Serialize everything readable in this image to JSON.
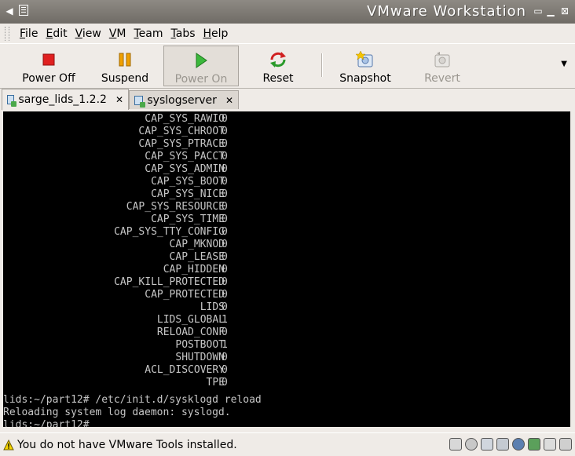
{
  "window": {
    "title": "VMware Workstation"
  },
  "menu": [
    {
      "label": "File",
      "u": "F",
      "rest": "ile"
    },
    {
      "label": "Edit",
      "u": "E",
      "rest": "dit"
    },
    {
      "label": "View",
      "u": "V",
      "rest": "iew"
    },
    {
      "label": "VM",
      "u": "V",
      "rest": "M"
    },
    {
      "label": "Team",
      "u": "T",
      "rest": "eam"
    },
    {
      "label": "Tabs",
      "u": "T",
      "rest": "abs"
    },
    {
      "label": "Help",
      "u": "H",
      "rest": "elp"
    }
  ],
  "toolbar": {
    "power_off": "Power Off",
    "suspend": "Suspend",
    "power_on": "Power On",
    "reset": "Reset",
    "snapshot": "Snapshot",
    "revert": "Revert"
  },
  "tabs": [
    {
      "label": "sarge_lids_1.2.2",
      "close": "✕"
    },
    {
      "label": "syslogserver",
      "close": "✕"
    }
  ],
  "console": {
    "caps": [
      [
        "CAP_SYS_RAWIO",
        "0"
      ],
      [
        "CAP_SYS_CHROOT",
        "0"
      ],
      [
        "CAP_SYS_PTRACE",
        "0"
      ],
      [
        "CAP_SYS_PACCT",
        "0"
      ],
      [
        "CAP_SYS_ADMIN",
        "0"
      ],
      [
        "CAP_SYS_BOOT",
        "0"
      ],
      [
        "CAP_SYS_NICE",
        "0"
      ],
      [
        "CAP_SYS_RESOURCE",
        "0"
      ],
      [
        "CAP_SYS_TIME",
        "0"
      ],
      [
        "CAP_SYS_TTY_CONFIG",
        "0"
      ],
      [
        "CAP_MKNOD",
        "0"
      ],
      [
        "CAP_LEASE",
        "0"
      ],
      [
        "CAP_HIDDEN",
        "0"
      ],
      [
        "CAP_KILL_PROTECTED",
        "0"
      ],
      [
        "CAP_PROTECTED",
        "0"
      ],
      [
        "LIDS",
        "0"
      ],
      [
        "LIDS_GLOBAL",
        "1"
      ],
      [
        "RELOAD_CONF",
        "0"
      ],
      [
        "POSTBOOT",
        "1"
      ],
      [
        "SHUTDOWN",
        "0"
      ],
      [
        "ACL_DISCOVERY",
        "0"
      ],
      [
        "TPE",
        "0"
      ]
    ],
    "command_line": "lids:~/part12# /etc/init.d/sysklogd reload",
    "output_line": "Reloading system log daemon: syslogd.",
    "prompt_line": "lids:~/part12#"
  },
  "status": {
    "message": "You do not have VMware Tools installed."
  },
  "colors": {
    "console_bg": "#000000",
    "console_text": "#c6c6c6",
    "chrome": "#efebe7"
  }
}
